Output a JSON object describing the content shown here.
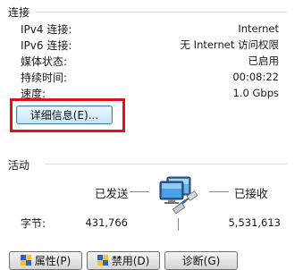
{
  "connection": {
    "title": "连接",
    "rows": [
      {
        "label": "IPv4 连接:",
        "value": "Internet"
      },
      {
        "label": "IPv6 连接:",
        "value": "无 Internet 访问权限"
      },
      {
        "label": "媒体状态:",
        "value": "已启用"
      },
      {
        "label": "持续时间:",
        "value": "00:08:22"
      },
      {
        "label": "速度:",
        "value": "1.0 Gbps"
      }
    ],
    "details_button": "详细信息(E)..."
  },
  "activity": {
    "title": "活动",
    "sent_label": "已发送",
    "received_label": "已接收",
    "bytes_label": "字节:",
    "bytes_sent": "431,766",
    "bytes_received": "5,531,613"
  },
  "buttons": {
    "properties": "属性(P)",
    "disable": "禁用(D)",
    "diagnose": "诊断(G)"
  },
  "colors": {
    "highlight": "#e3101b",
    "divider": "#d5dfe5"
  },
  "icons": {
    "network": "network-computer-icon",
    "shield": "uac-shield-icon"
  }
}
